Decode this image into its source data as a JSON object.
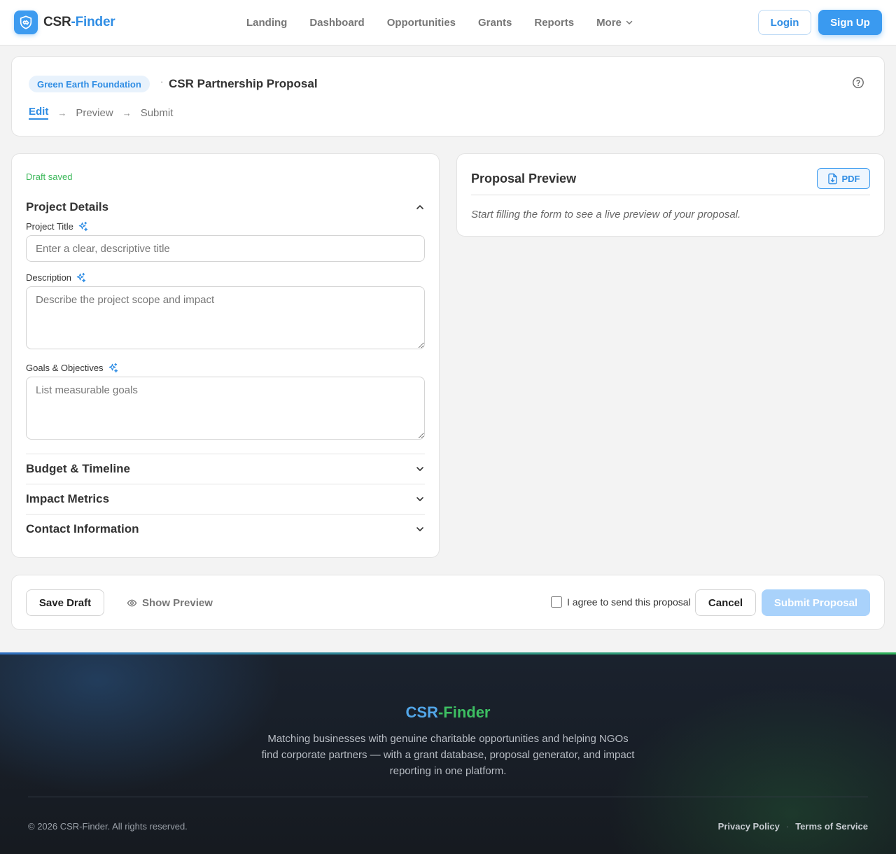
{
  "brand": {
    "name_part1": "CSR",
    "name_part2": "-Finder"
  },
  "nav": {
    "items": [
      "Landing",
      "Dashboard",
      "Opportunities",
      "Grants",
      "Reports"
    ],
    "more_label": "More"
  },
  "auth": {
    "login_label": "Login",
    "signup_label": "Sign Up"
  },
  "proposal": {
    "org_badge": "Green Earth Foundation",
    "separator": "·",
    "title": "CSR Partnership Proposal",
    "steps": {
      "edit": "Edit",
      "preview": "Preview",
      "submit": "Submit",
      "arrow": "→"
    }
  },
  "form": {
    "draft_status": "Draft saved",
    "sections": {
      "project_details": "Project Details",
      "budget_timeline": "Budget & Timeline",
      "impact_metrics": "Impact Metrics",
      "contact_information": "Contact Information"
    },
    "fields": {
      "project_title": {
        "label": "Project Title",
        "placeholder": "Enter a clear, descriptive title",
        "value": ""
      },
      "description": {
        "label": "Description",
        "placeholder": "Describe the project scope and impact",
        "value": ""
      },
      "goals": {
        "label": "Goals & Objectives",
        "placeholder": "List measurable goals",
        "value": ""
      }
    }
  },
  "preview": {
    "title": "Proposal Preview",
    "pdf_label": "PDF",
    "empty_text": "Start filling the form to see a live preview of your proposal."
  },
  "actions": {
    "save_draft": "Save Draft",
    "show_preview": "Show Preview",
    "agree_label": "I agree to send this proposal",
    "agree_checked": false,
    "cancel": "Cancel",
    "submit": "Submit Proposal"
  },
  "footer": {
    "brand_part1": "CSR",
    "brand_part2": "-Finder",
    "description": "Matching businesses with genuine charitable opportunities and helping NGOs find corporate partners — with a grant database, proposal generator, and impact reporting in one platform.",
    "copyright": "© 2026 CSR-Finder. All rights reserved.",
    "privacy": "Privacy Policy",
    "link_separator": "·",
    "terms": "Terms of Service"
  },
  "colors": {
    "accent": "#3a9af0",
    "success": "#3cb85a",
    "footer_bg": "#161a20"
  }
}
